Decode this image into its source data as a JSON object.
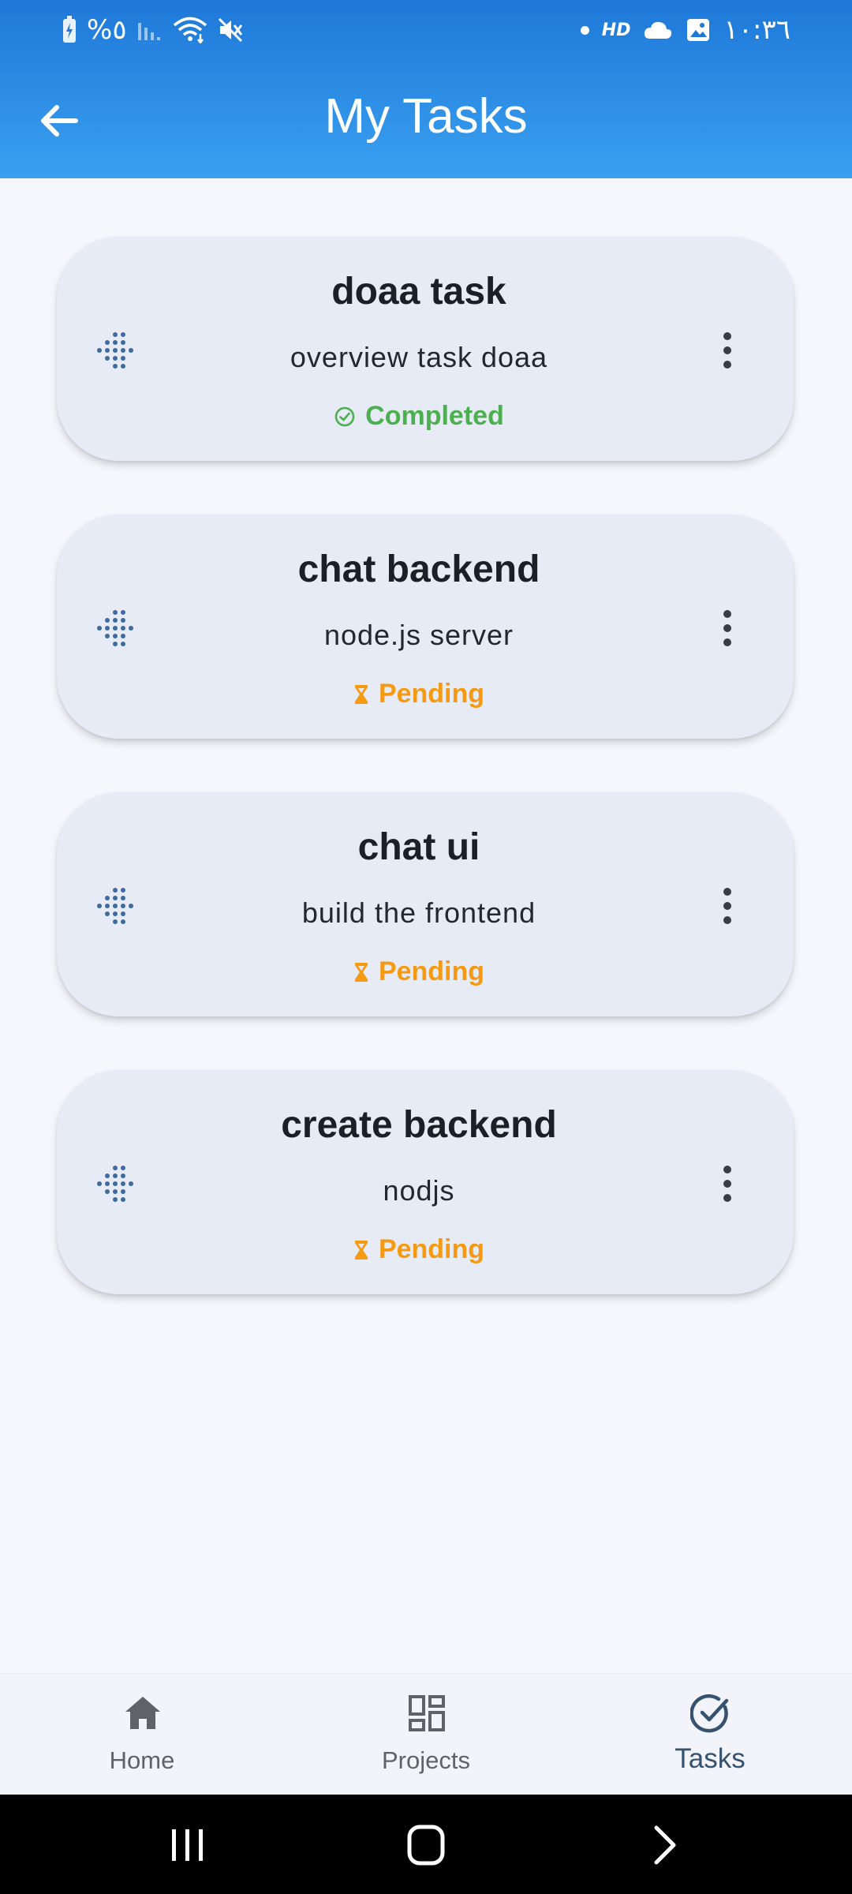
{
  "status_bar": {
    "battery_text": "%٥",
    "time": "١٠:٣٦",
    "hd_label": "HD"
  },
  "header": {
    "title": "My Tasks"
  },
  "tasks": [
    {
      "title": "doaa task",
      "description": "overview task doaa",
      "status": "Completed"
    },
    {
      "title": "chat backend",
      "description": "node.js server",
      "status": "Pending"
    },
    {
      "title": "chat ui",
      "description": "build the frontend",
      "status": "Pending"
    },
    {
      "title": "create backend",
      "description": "nodjs",
      "status": "Pending"
    }
  ],
  "bottom_nav": {
    "items": [
      {
        "label": "Home",
        "icon": "home-icon"
      },
      {
        "label": "Projects",
        "icon": "dashboard-icon"
      },
      {
        "label": "Tasks",
        "icon": "task-check-icon"
      }
    ],
    "active": "Tasks"
  },
  "colors": {
    "header_top": "#1e78d8",
    "header_bottom": "#3aa0f0",
    "card_bg": "#e6ebf5",
    "completed": "#4caf50",
    "pending": "#f59a12",
    "drag_icon": "#3d6b9f"
  }
}
